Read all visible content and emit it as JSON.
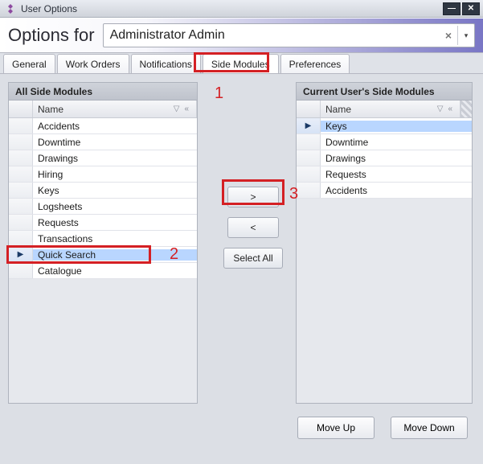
{
  "window": {
    "title": "User Options",
    "min_icon": "—",
    "close_icon": "✕"
  },
  "options_for": {
    "label": "Options for",
    "value": "Administrator Admin"
  },
  "tabs": [
    {
      "label": "General",
      "active": false
    },
    {
      "label": "Work Orders",
      "active": false
    },
    {
      "label": "Notifications",
      "active": false
    },
    {
      "label": "Side Modules",
      "active": true
    },
    {
      "label": "Preferences",
      "active": false
    }
  ],
  "left_panel": {
    "title": "All Side Modules",
    "column": "Name",
    "rows": [
      {
        "name": "Accidents"
      },
      {
        "name": "Downtime"
      },
      {
        "name": "Drawings"
      },
      {
        "name": "Hiring"
      },
      {
        "name": "Keys"
      },
      {
        "name": "Logsheets"
      },
      {
        "name": "Requests"
      },
      {
        "name": "Transactions"
      },
      {
        "name": "Quick Search",
        "selected": true
      },
      {
        "name": "Catalogue"
      }
    ]
  },
  "right_panel": {
    "title": "Current User's Side Modules",
    "column": "Name",
    "rows": [
      {
        "name": "Keys",
        "selected": true
      },
      {
        "name": "Downtime"
      },
      {
        "name": "Drawings"
      },
      {
        "name": "Requests"
      },
      {
        "name": "Accidents"
      }
    ]
  },
  "transfer": {
    "add": ">",
    "remove": "<",
    "select_all": "Select All"
  },
  "reorder": {
    "move_up": "Move Up",
    "move_down": "Move Down"
  },
  "callouts": {
    "one": "1",
    "two": "2",
    "three": "3"
  }
}
